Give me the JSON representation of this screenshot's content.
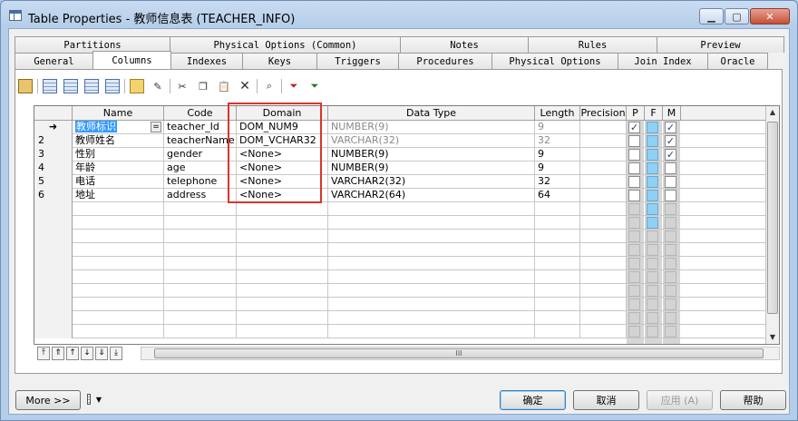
{
  "window": {
    "title": "Table Properties - 教师信息表 (TEACHER_INFO)",
    "controls": [
      "minimize",
      "maximize",
      "close"
    ]
  },
  "tabs": {
    "row1": [
      "Partitions",
      "Physical Options (Common)",
      "Notes",
      "Rules",
      "Preview"
    ],
    "row2": [
      "General",
      "Columns",
      "Indexes",
      "Keys",
      "Triggers",
      "Procedures",
      "Physical Options",
      "Join Index",
      "Oracle"
    ],
    "active": "Columns"
  },
  "toolbar": {
    "icons": [
      "properties-icon",
      "insert-row-icon",
      "add-row-icon",
      "add-columns-icon",
      "add-attribute-icon",
      "new-icon",
      "insert-icon",
      "cut-icon",
      "copy-icon",
      "paste-icon",
      "delete-icon",
      "find-icon",
      "filter-icon",
      "filter-clear-icon"
    ]
  },
  "grid": {
    "headers": [
      "Name",
      "Code",
      "Domain",
      "Data Type",
      "Length",
      "Precision",
      "P",
      "F",
      "M"
    ],
    "rows": [
      {
        "num": "➜",
        "name": "教师标识",
        "code": "teacher_Id",
        "domain": "DOM_NUM9",
        "datatype": "NUMBER(9)",
        "length": "9",
        "precision": "",
        "p": true,
        "f": false,
        "m": true,
        "greytype": true
      },
      {
        "num": "2",
        "name": "教师姓名",
        "code": "teacherName",
        "domain": "DOM_VCHAR32",
        "datatype": "VARCHAR(32)",
        "length": "32",
        "precision": "",
        "p": false,
        "f": false,
        "m": true,
        "greytype": true
      },
      {
        "num": "3",
        "name": "性别",
        "code": "gender",
        "domain": "<None>",
        "datatype": "NUMBER(9)",
        "length": "9",
        "precision": "",
        "p": false,
        "f": false,
        "m": true,
        "greytype": false
      },
      {
        "num": "4",
        "name": "年龄",
        "code": "age",
        "domain": "<None>",
        "datatype": "NUMBER(9)",
        "length": "9",
        "precision": "",
        "p": false,
        "f": false,
        "m": false,
        "greytype": false
      },
      {
        "num": "5",
        "name": "电话",
        "code": "telephone",
        "domain": "<None>",
        "datatype": "VARCHAR2(32)",
        "length": "32",
        "precision": "",
        "p": false,
        "f": false,
        "m": false,
        "greytype": false
      },
      {
        "num": "6",
        "name": "地址",
        "code": "address",
        "domain": "<None>",
        "datatype": "VARCHAR2(64)",
        "length": "64",
        "precision": "",
        "p": false,
        "f": false,
        "m": false,
        "greytype": false
      }
    ],
    "empty_rows": 10,
    "eq_button": "="
  },
  "nav": [
    "⤒",
    "⇑",
    "↑",
    "↓",
    "⇓",
    "⤓"
  ],
  "hscroll": {
    "grip": "III"
  },
  "footer": {
    "more": "More >>",
    "ok": "确定",
    "cancel": "取消",
    "apply": "应用 (A)",
    "help": "帮助"
  },
  "colors": {
    "highlight": "#d9342b",
    "selection": "#3399ff",
    "checkbox_blue": "#8fd0f5"
  }
}
